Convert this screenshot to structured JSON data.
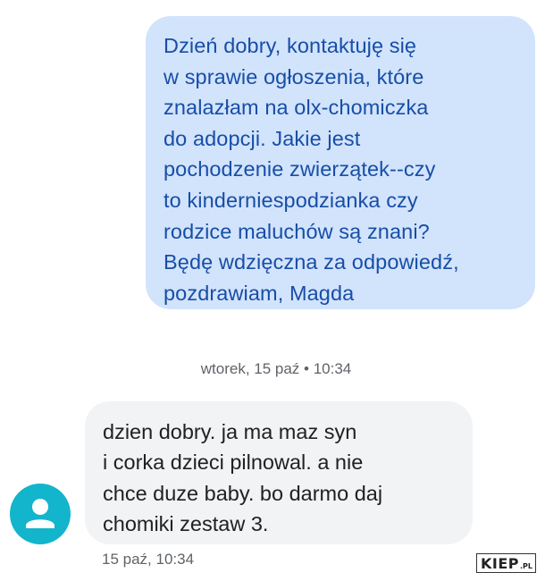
{
  "outgoing_message": {
    "lines": [
      "Dzień dobry, kontaktuję się",
      "w sprawie ogłoszenia, które",
      "znalazłam na olx-chomiczka",
      "do adopcji. Jakie jest",
      "pochodzenie zwierzątek--czy",
      "to kinderniespodzianka czy",
      "rodzice maluchów są znani?",
      "Będę wdzięczna za odpowiedź,",
      "pozdrawiam, Magda"
    ]
  },
  "date_separator": "wtorek, 15 paź • 10:34",
  "incoming_message": {
    "lines": [
      "dzien dobry. ja ma maz syn",
      "i corka dzieci pilnowal. a nie",
      "chce  duze baby. bo darmo  daj",
      "chomiki zestaw 3."
    ],
    "timestamp": "15 paź, 10:34",
    "avatar_icon": "person-icon"
  },
  "watermark": {
    "main": "KIEP",
    "suffix": ".PL"
  },
  "colors": {
    "outgoing_bubble": "#d2e3fc",
    "outgoing_text": "#174ea6",
    "incoming_bubble": "#f1f3f4",
    "avatar": "#12b5cb"
  }
}
